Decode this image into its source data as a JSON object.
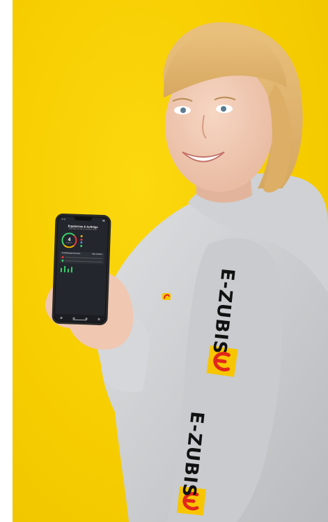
{
  "brand": {
    "sleeve_text": "E-ZUBIS",
    "accent_yellow": "#f6cd00",
    "logo_red": "#e3261c",
    "logo_yellow": "#f7c600"
  },
  "phone_screen": {
    "time": "9:41",
    "title": "Ergebnisse & Aufträge",
    "subtitle": "Hier siehst du deinen aktuellen Stand",
    "ring_value": "4",
    "ring_label": "Aufgaben",
    "section_title": "Ausbildungsnachweise",
    "section_link": "Alle ansehen"
  }
}
